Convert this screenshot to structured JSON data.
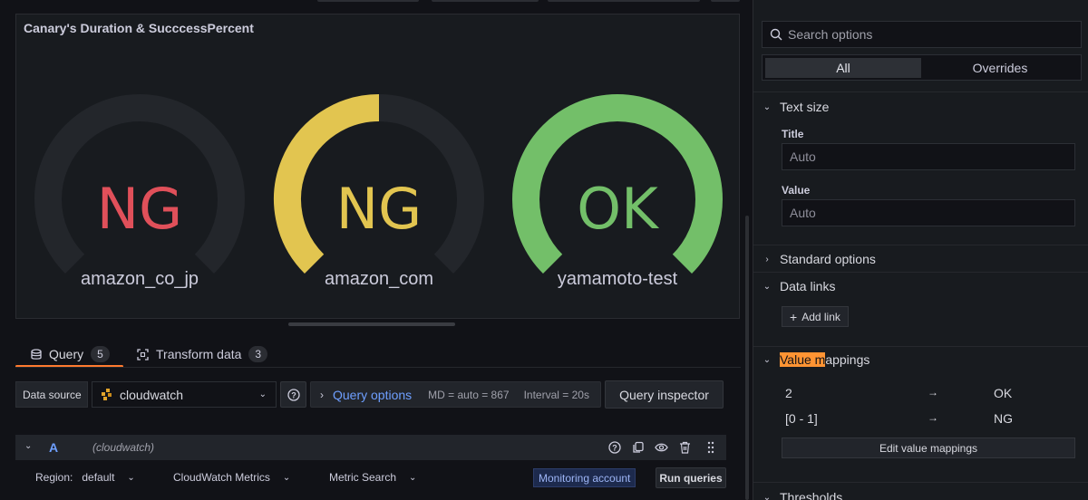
{
  "panel": {
    "title": "Canary's Duration & SucccessPercent",
    "gauges": [
      {
        "value_text": "NG",
        "name": "amazon_co_jp",
        "fill_fraction": 0.0,
        "color": "#e0505a"
      },
      {
        "value_text": "NG",
        "name": "amazon_com",
        "fill_fraction": 0.5,
        "color": "#e2c550"
      },
      {
        "value_text": "OK",
        "name": "yamamoto-test",
        "fill_fraction": 1.0,
        "color": "#73bf69"
      }
    ],
    "track_color": "#23262b"
  },
  "tabs": {
    "query": {
      "label": "Query",
      "count": "5"
    },
    "transform": {
      "label": "Transform data",
      "count": "3"
    }
  },
  "query_row": {
    "data_source_label": "Data source",
    "data_source_value": "cloudwatch",
    "query_options_label": "Query options",
    "md_text": "MD = auto = 867",
    "interval_text": "Interval = 20s",
    "inspector_label": "Query inspector"
  },
  "query_a": {
    "ref": "A",
    "source": "(cloudwatch)",
    "region_label": "Region:",
    "region_value": "default",
    "metrics_value": "CloudWatch Metrics",
    "search_value": "Metric Search",
    "monitoring_label": "Monitoring account",
    "run_label": "Run queries"
  },
  "options": {
    "search_placeholder": "Search options",
    "tab_all": "All",
    "tab_overrides": "Overrides",
    "text_size": {
      "header": "Text size",
      "title_label": "Title",
      "title_placeholder": "Auto",
      "value_label": "Value",
      "value_placeholder": "Auto"
    },
    "standard_options": "Standard options",
    "data_links": {
      "header": "Data links",
      "add_label": "Add link"
    },
    "value_mappings": {
      "header_highlight": "Value m",
      "header_rest": "appings",
      "rows": [
        {
          "from": "2",
          "arrow": "→",
          "to": "OK"
        },
        {
          "from": "[0 - 1]",
          "arrow": "→",
          "to": "NG"
        }
      ],
      "edit_label": "Edit value mappings"
    },
    "thresholds": "Thresholds"
  }
}
